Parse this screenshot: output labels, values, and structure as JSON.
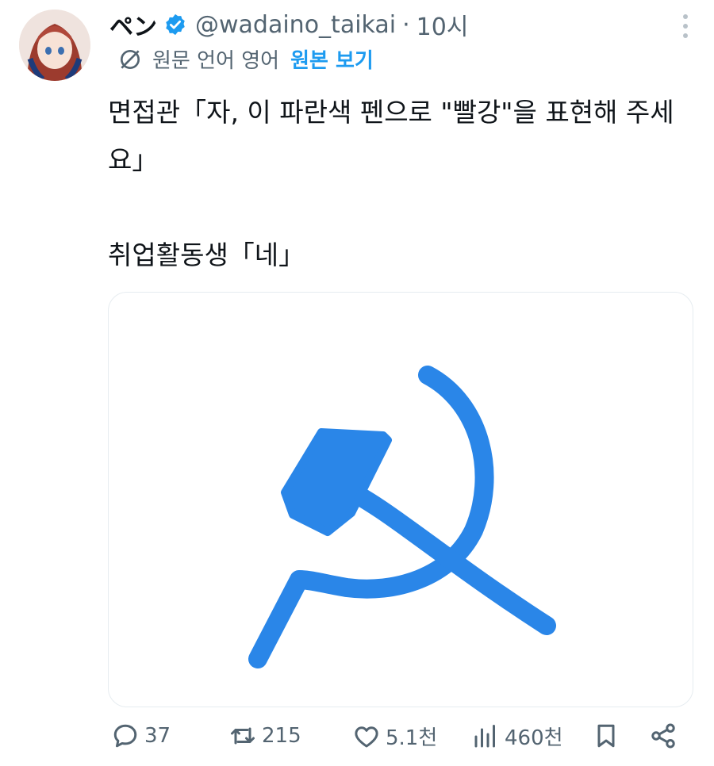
{
  "author": {
    "display_name": "ペン",
    "handle": "@wadaino_taikai",
    "separator": "·",
    "time": "10시"
  },
  "translation": {
    "source_language": "원문 언어 영어",
    "show_original": "원본 보기"
  },
  "tweet": {
    "line1": "면접관「자, 이 파란색 펜으로 \"빨강\"을 표현해 주세요」",
    "line2": "취업활동생「네」"
  },
  "actions": {
    "replies": "37",
    "retweets": "215",
    "likes": "5.1천",
    "views": "460천"
  },
  "colors": {
    "accent": "#1d9bf0",
    "drawing_blue": "#2a86e8",
    "muted": "#536471"
  },
  "icons": [
    "verified-badge-icon",
    "translate-icon",
    "more-icon",
    "reply-icon",
    "retweet-icon",
    "like-icon",
    "views-icon",
    "bookmark-icon",
    "share-icon"
  ]
}
